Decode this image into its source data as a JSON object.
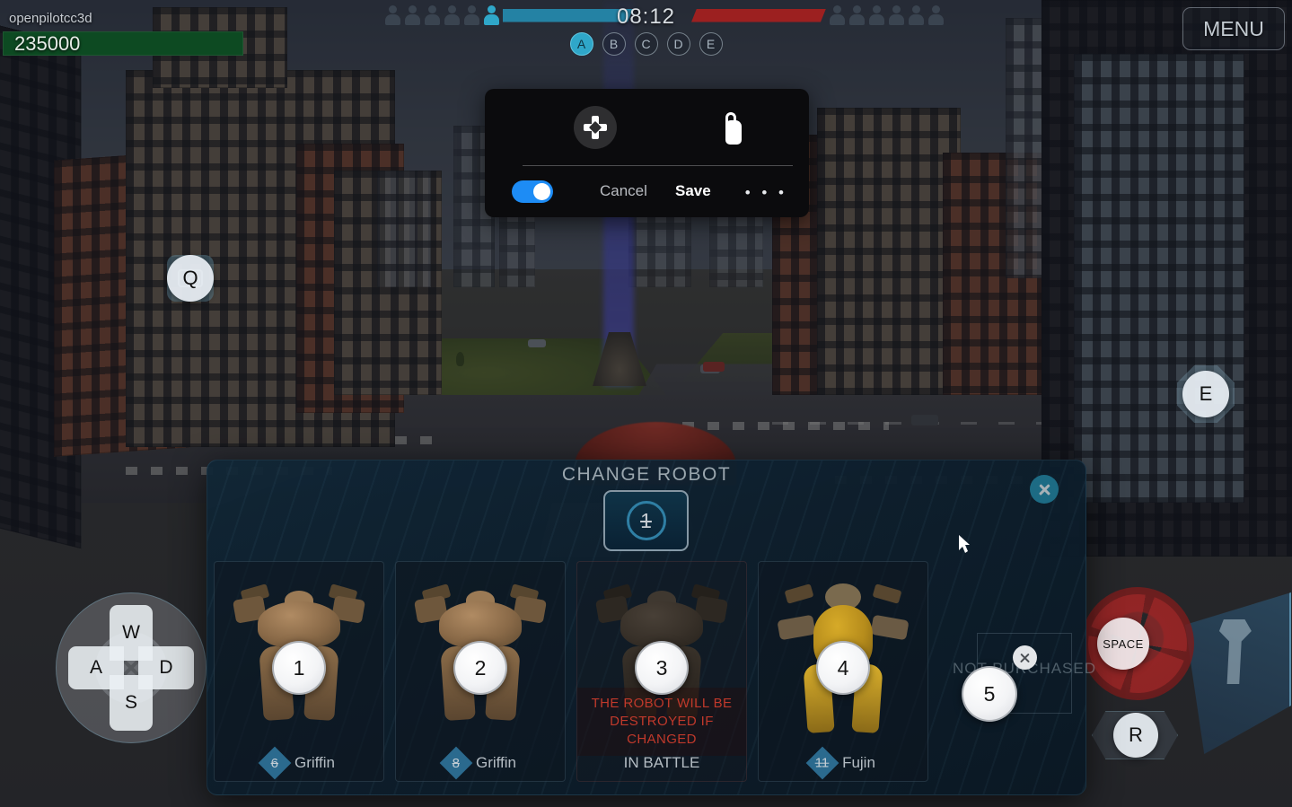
{
  "hud": {
    "player_name": "openpilotcc3d",
    "health": "235000",
    "timer": "08:12",
    "menu_label": "MENU",
    "blue_team_alive": 1,
    "blue_team_total": 6,
    "red_team_alive": 0,
    "red_team_total": 6,
    "beacons": [
      {
        "label": "A",
        "owned": true
      },
      {
        "label": "B",
        "owned": false
      },
      {
        "label": "C",
        "owned": false
      },
      {
        "label": "D",
        "owned": false
      },
      {
        "label": "E",
        "owned": false
      }
    ],
    "colors": {
      "blue_team": "#2482a4",
      "red_team": "#9c2020",
      "health_bar": "#0d4a22"
    }
  },
  "key_overlay": {
    "camera_key": "Q",
    "ability_key": "E",
    "fire_key": "SPACE",
    "repair_key": "R",
    "move_keys": {
      "up": "W",
      "left": "A",
      "down": "S",
      "right": "D"
    }
  },
  "control_dialog": {
    "dpad_icon": "dpad-icon",
    "tap_icon": "tap-hand-icon",
    "toggle_on": true,
    "cancel_label": "Cancel",
    "save_label": "Save",
    "more_label": "• • •",
    "accent": "#1d8cf5"
  },
  "change_robot": {
    "title": "CHANGE ROBOT",
    "selected_slot": "1",
    "close_icon": "close-icon",
    "cards": [
      {
        "marker": "1",
        "level": "6",
        "name": "Griffin",
        "state": "available"
      },
      {
        "marker": "2",
        "level": "8",
        "name": "Griffin",
        "state": "available"
      },
      {
        "marker": "3",
        "level": "",
        "name": "IN BATTLE",
        "state": "in-battle",
        "warning": "THE ROBOT WILL BE DESTROYED IF CHANGED"
      },
      {
        "marker": "4",
        "level": "11",
        "name": "Fujin",
        "state": "available"
      },
      {
        "marker": "5",
        "level": "",
        "name": "NOT PURCHASED",
        "state": "locked"
      }
    ]
  }
}
